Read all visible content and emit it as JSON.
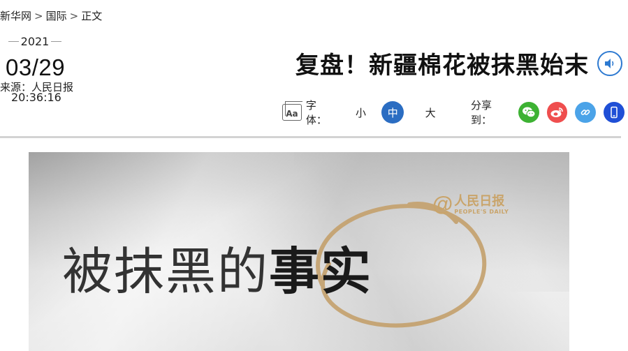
{
  "breadcrumb": {
    "items": [
      "新华网",
      "国际",
      "正文"
    ],
    "separator": ">"
  },
  "date": {
    "year": "2021",
    "day": "03/29",
    "time": "20:36:16"
  },
  "source": "来源：人民日报",
  "headline": "复盘！新疆棉花被抹黑始末",
  "toolbar": {
    "font_label": "字体：",
    "font_sizes": [
      "小",
      "中",
      "大"
    ],
    "selected_font_size": "中",
    "share_label": "分享到：",
    "share_icons": [
      "wechat-icon",
      "weibo-icon",
      "link-icon",
      "mobile-icon"
    ]
  },
  "hero": {
    "text_light": "被抹黑的",
    "text_bold": "事实",
    "logo_at": "@",
    "logo_cn": "人民日报",
    "logo_en": "PEOPLE'S DAILY"
  },
  "colors": {
    "accent_blue": "#2b6dc2",
    "wechat": "#3db233",
    "weibo": "#ef4e4e",
    "link": "#4ba3e8",
    "mobile": "#1f4fd6",
    "logo_gold": "#c9a46a"
  }
}
